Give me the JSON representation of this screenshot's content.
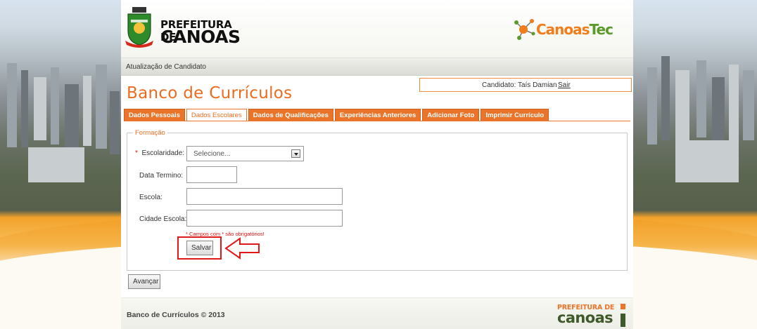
{
  "header": {
    "logo_line1": "PREFEITURA DE",
    "logo_line2": "CANOAS",
    "canoastec_part1": "Canoas",
    "canoastec_part2": "Tec"
  },
  "breadcrumb": "Atualização de Candidato",
  "page_title": "Banco de Currículos",
  "candidate": {
    "label": "Candidato: Taís Damian",
    "logout": "Sair"
  },
  "tabs": [
    {
      "label": "Dados Pessoais",
      "active": false
    },
    {
      "label": "Dados Escolares",
      "active": true
    },
    {
      "label": "Dados de Qualificações",
      "active": false
    },
    {
      "label": "Experiências Anteriores",
      "active": false
    },
    {
      "label": "Adicionar Foto",
      "active": false
    },
    {
      "label": "Imprimir Currículo",
      "active": false
    }
  ],
  "form": {
    "legend": "Formação",
    "escolaridade_label": "Escolaridade:",
    "escolaridade_required_mark": "*",
    "escolaridade_value": "Selecione...",
    "data_termino_label": "Data Termino:",
    "data_termino_value": "",
    "escola_label": "Escola:",
    "escola_value": "",
    "cidade_label": "Cidade Escola:",
    "cidade_value": "",
    "required_note": "* Campos com * são obrigatórios!",
    "save_button": "Salvar",
    "next_button": "Avançar"
  },
  "footer": {
    "copyright": "Banco de Currículos © 2013",
    "logo_line1": "PREFEITURA DE",
    "logo_line2": "canoas"
  },
  "colors": {
    "accent_orange": "#ec6c1f",
    "tab_orange": "#e9742a",
    "highlight_red": "#e01818",
    "green": "#5a9a2a"
  },
  "icons": [
    "city-crest-icon",
    "canoastec-molecule-icon",
    "dropdown-arrow-icon",
    "pointer-arrow-icon"
  ]
}
